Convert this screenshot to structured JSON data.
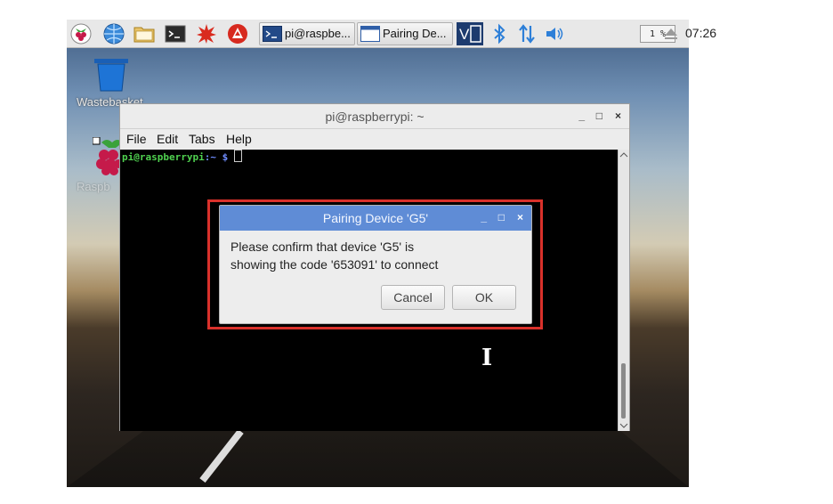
{
  "taskbar": {
    "tasks": [
      {
        "label": "pi@raspbe..."
      },
      {
        "label": "Pairing De..."
      }
    ],
    "cpu_usage": "1 %",
    "clock": "07:26"
  },
  "desktop": {
    "icons": [
      {
        "label": "Wastebasket"
      },
      {
        "label": "Raspb"
      }
    ]
  },
  "terminal": {
    "title": "pi@raspberrypi: ~",
    "menu": [
      "File",
      "Edit",
      "Tabs",
      "Help"
    ],
    "prompt_user": "pi@raspberrypi",
    "prompt_path": ":~ $"
  },
  "dialog": {
    "title": "Pairing Device 'G5'",
    "message_line1": "Please confirm that device 'G5' is",
    "message_line2": "showing the code '653091' to connect",
    "cancel_label": "Cancel",
    "ok_label": "OK"
  },
  "window_controls": {
    "minimize": "_",
    "maximize": "□",
    "close": "×"
  },
  "colors": {
    "dialog_titlebar": "#5f8cd6",
    "highlight_border": "#d9312b",
    "prompt_green": "#4fd14f",
    "prompt_blue": "#6f8dff"
  }
}
